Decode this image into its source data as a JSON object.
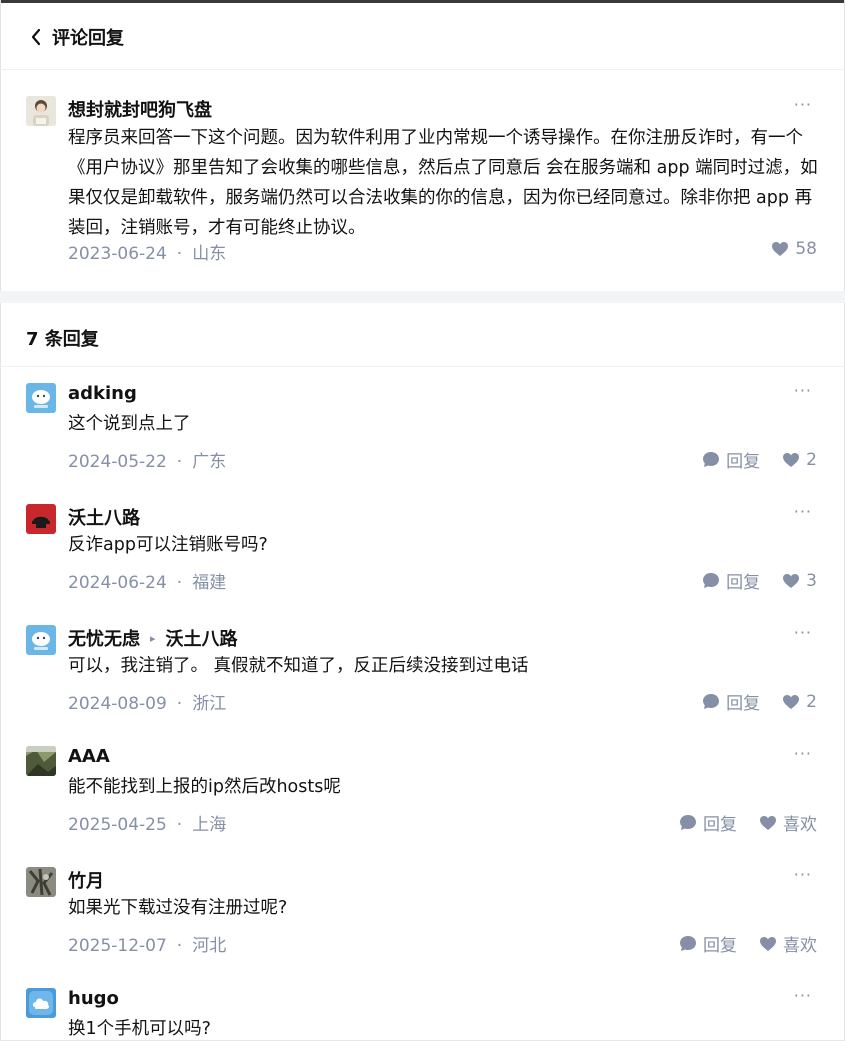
{
  "header": {
    "title": "评论回复"
  },
  "main_comment": {
    "author": "想封就封吧狗飞盘",
    "content": "程序员来回答一下这个问题。因为软件利用了业内常规一个诱导操作。在你注册反诈时，有一个《用户协议》那里告知了会收集的哪些信息，然后点了同意后 会在服务端和 app 端同时过滤，如果仅仅是卸载软件，服务端仍然可以合法收集的你的信息，因为你已经同意过。除非你把 app 再装回，注销账号，才有可能终止协议。",
    "date": "2023-06-24",
    "location": "山东",
    "likes": "58",
    "more": "···"
  },
  "replies_title": "7 条回复",
  "separator": "·",
  "reply_label": "回复",
  "replies": [
    {
      "author": "adking",
      "content": "这个说到点上了",
      "date": "2024-05-22",
      "location": "广东",
      "likes": "2",
      "more": "···"
    },
    {
      "author": "沃土八路",
      "content": "反诈app可以注销账号吗?",
      "date": "2024-06-24",
      "location": "福建",
      "likes": "3",
      "more": "···"
    },
    {
      "author": "无忧无虑",
      "reply_to": "沃土八路",
      "content": "可以，我注销了。 真假就不知道了，反正后续没接到过电话",
      "date": "2024-08-09",
      "location": "浙江",
      "likes": "2",
      "more": "···"
    },
    {
      "author": "AAA",
      "content": "能不能找到上报的ip然后改hosts呢",
      "date": "2025-04-25",
      "location": "上海",
      "likes": "喜欢",
      "more": "···"
    },
    {
      "author": "竹月",
      "content": "如果光下载过没有注册过呢?",
      "date": "2025-12-07",
      "location": "河北",
      "likes": "喜欢",
      "more": "···"
    },
    {
      "author": "hugo",
      "content": "换1个手机可以吗?",
      "more": "···"
    }
  ],
  "colors": {
    "meta": "#8590a6",
    "text": "#121212",
    "divider": "#f3f4f6"
  }
}
